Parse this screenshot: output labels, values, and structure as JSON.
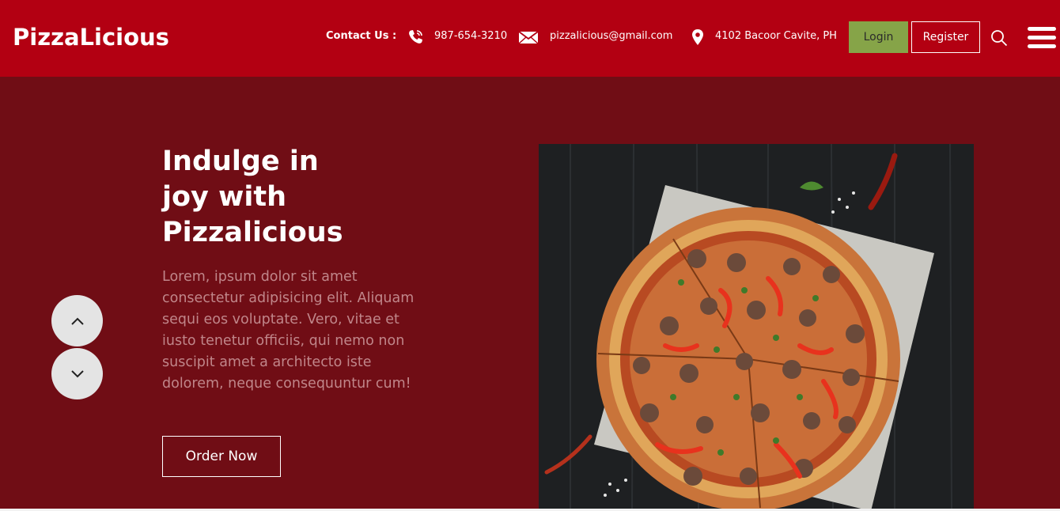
{
  "header": {
    "logo": "PizzaLicious",
    "contact_label": "Contact Us :",
    "phone": "987-654-3210",
    "email": "pizzalicious@gmail.com",
    "address": "4102 Bacoor Cavite, PH",
    "login_label": "Login",
    "register_label": "Register",
    "icons": [
      "phone-icon",
      "mail-icon",
      "location-pin-icon",
      "search-icon",
      "hamburger-menu-icon"
    ]
  },
  "hero": {
    "title_lines": [
      "Indulge in",
      "joy with",
      "Pizzalicious"
    ],
    "description": "Lorem, ipsum dolor sit amet consectetur adipisicing elit. Aliquam sequi eos voluptate. Vero, vitae et iusto tenetur officiis, qui nemo non suscipit amet a architecto iste dolorem, neque consequuntur cum!",
    "order_label": "Order Now"
  },
  "slider": {
    "icons": [
      "chevron-up-icon",
      "chevron-down-icon"
    ]
  },
  "colors": {
    "header_bg": "#b30012",
    "hero_bg": "#700d15",
    "login_bg": "#86a448",
    "description_text": "#c0868a"
  }
}
